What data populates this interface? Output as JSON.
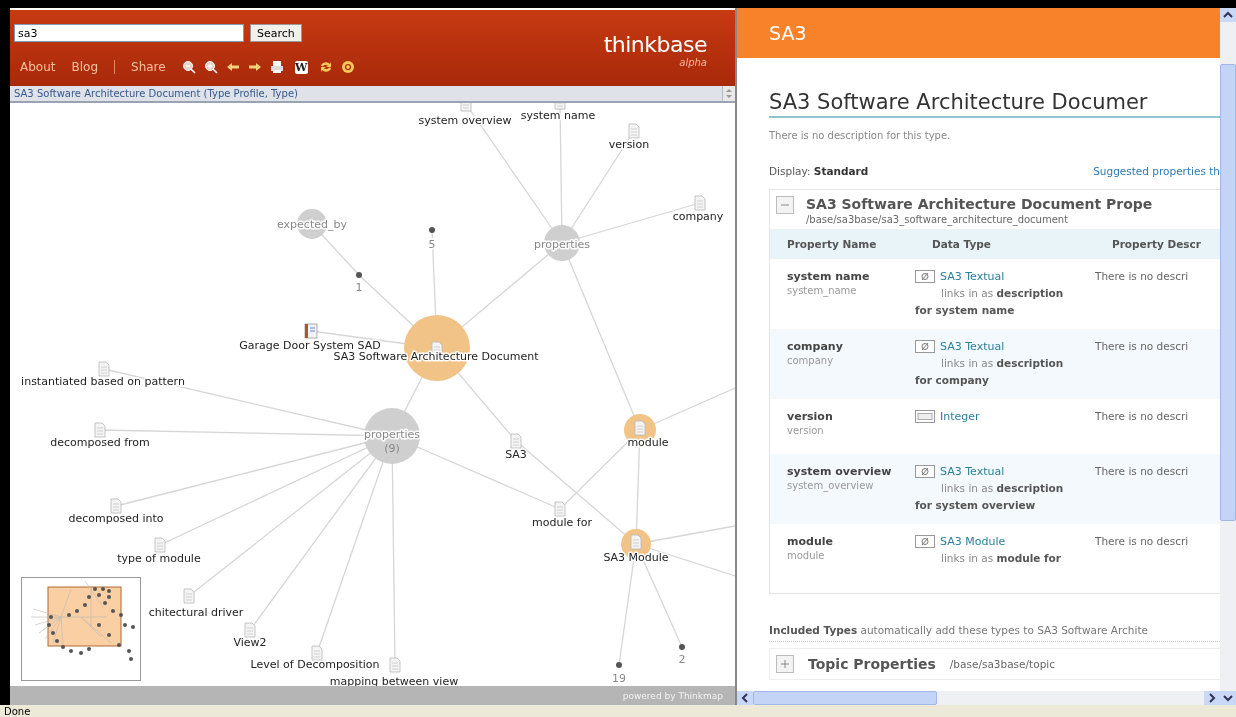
{
  "search": {
    "value": "sa3",
    "button": "Search"
  },
  "logo": {
    "name": "thinkbase",
    "tag": "alpha"
  },
  "nav": {
    "links": [
      "About",
      "Blog"
    ],
    "share": "Share",
    "wiki_glyph": "W"
  },
  "breadcrumb": "SA3 Software Architecture Document (Type Profile, Type)",
  "graph": {
    "nodes": [
      {
        "label": "system overview",
        "kind": "doc"
      },
      {
        "label": "system name",
        "kind": "doc"
      },
      {
        "label": "version",
        "kind": "doc"
      },
      {
        "label": "company",
        "kind": "doc"
      },
      {
        "label": "properties",
        "kind": "grey"
      },
      {
        "label": "expected_by",
        "kind": "grey"
      },
      {
        "label": "5",
        "kind": "dot"
      },
      {
        "label": "1",
        "kind": "dot"
      },
      {
        "label": "Garage Door System SAD",
        "kind": "book"
      },
      {
        "label": "SA3 Software Architecture Document",
        "kind": "orange"
      },
      {
        "label": "instantiated based on pattern",
        "kind": "doc"
      },
      {
        "label": "decomposed from",
        "kind": "doc"
      },
      {
        "label": "properties",
        "count": "(9)",
        "kind": "grey"
      },
      {
        "label": "SA3",
        "kind": "doc"
      },
      {
        "label": "module",
        "kind": "orange"
      },
      {
        "label": "decomposed into",
        "kind": "doc"
      },
      {
        "label": "module for",
        "kind": "doc"
      },
      {
        "label": "type of module",
        "kind": "doc"
      },
      {
        "label": "SA3 Module",
        "kind": "orange"
      },
      {
        "label": "chitectural driver",
        "kind": "doc"
      },
      {
        "label": "View2",
        "kind": "doc"
      },
      {
        "label": "Level of Decomposition",
        "kind": "doc"
      },
      {
        "label": "mapping between view",
        "kind": "doc"
      },
      {
        "label": "19",
        "kind": "dot"
      },
      {
        "label": "2",
        "kind": "dot"
      }
    ]
  },
  "footer": "powered by Thinkmap",
  "detail": {
    "header": "SA3",
    "title": "SA3 Software Architecture Documer",
    "description": "There is no description for this type.",
    "display_label": "Display:",
    "display_value": "Standard",
    "suggested": "Suggested properties th",
    "section": {
      "expanded": true,
      "title": "SA3 Software Architecture Document Prope",
      "path": "/base/sa3base/sa3_software_architecture_document",
      "columns": [
        "Property Name",
        "Data Type",
        "Property Descr"
      ],
      "rows": [
        {
          "name": "system name",
          "id": "system_name",
          "kind": "link",
          "type": "SA3 Textual",
          "links_in": "links in as **description for system name**",
          "description": "There is no descri"
        },
        {
          "name": "company",
          "id": "company",
          "kind": "link",
          "type": "SA3 Textual",
          "links_in": "links in as **description for company**",
          "description": "There is no descri"
        },
        {
          "name": "version",
          "id": "version",
          "kind": "integer",
          "type": "Integer",
          "description": "There is no descri"
        },
        {
          "name": "system overview",
          "id": "system_overview",
          "kind": "link",
          "type": "SA3 Textual",
          "links_in": "links in as **description for system overview**",
          "description": "There is no descri"
        },
        {
          "name": "module",
          "id": "module",
          "kind": "link",
          "type": "SA3 Module",
          "links_in": "links in as **module for**",
          "description": "There is no descri"
        }
      ]
    },
    "included": "**Included Types** automatically add these types to SA3 Software Archite",
    "topic": {
      "expanded": false,
      "title": "Topic Properties",
      "path": "/base/sa3base/topic"
    }
  },
  "status": "Done"
}
